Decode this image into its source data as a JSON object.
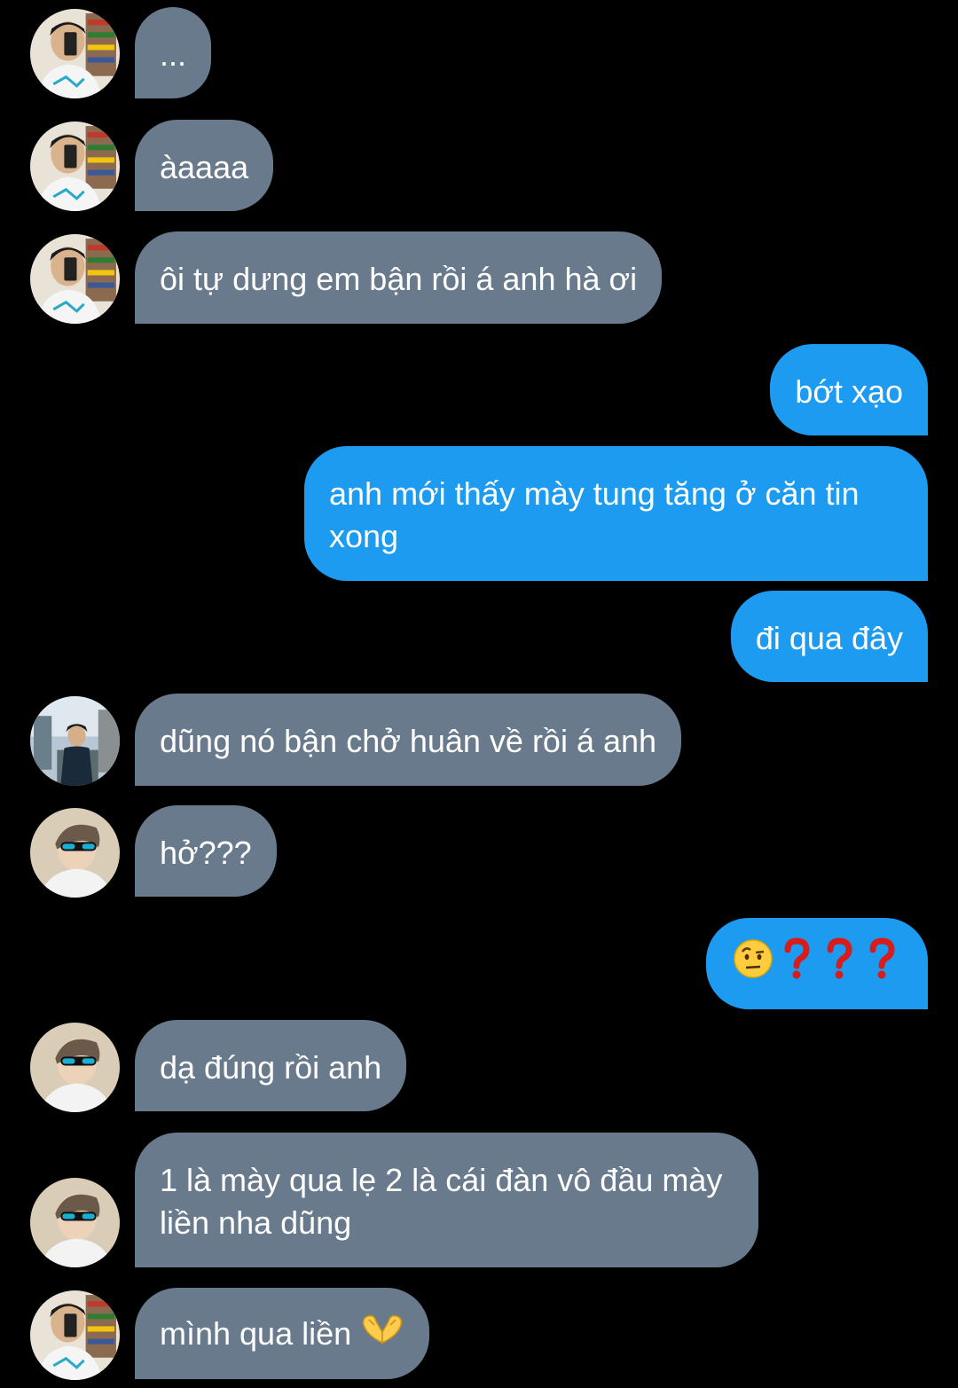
{
  "conversation": {
    "messages": [
      {
        "sender": "other",
        "text": "..."
      },
      {
        "sender": "other",
        "text": "àaaaa"
      },
      {
        "sender": "other",
        "text": "ôi tự dưng em bận rồi á anh hà ơi"
      },
      {
        "sender": "me",
        "text": "bớt xạo"
      },
      {
        "sender": "me",
        "text": "anh mới thấy mày tung tăng ở căn tin xong"
      },
      {
        "sender": "me",
        "text": "đi qua đây"
      },
      {
        "sender": "other",
        "text": "dũng nó bận chở huân về rồi á anh"
      },
      {
        "sender": "other",
        "text": "hở???"
      },
      {
        "sender": "me",
        "text": "",
        "icons": [
          "raised-eyebrow-face-emoji",
          "question-mark-emoji",
          "question-mark-emoji",
          "question-mark-emoji"
        ]
      },
      {
        "sender": "other",
        "text": "dạ đúng rồi anh"
      },
      {
        "sender": "other",
        "text": "1 là mày qua lẹ 2 là cái đàn vô đầu mày liền nha dũng"
      },
      {
        "sender": "other",
        "text": "mình qua liền ",
        "icons": [
          "heart-hands-emoji"
        ]
      }
    ]
  },
  "colors": {
    "background": "#000000",
    "incoming_bubble": "#687a8b",
    "outgoing_bubble": "#1d9bf0",
    "text": "#ffffff"
  }
}
